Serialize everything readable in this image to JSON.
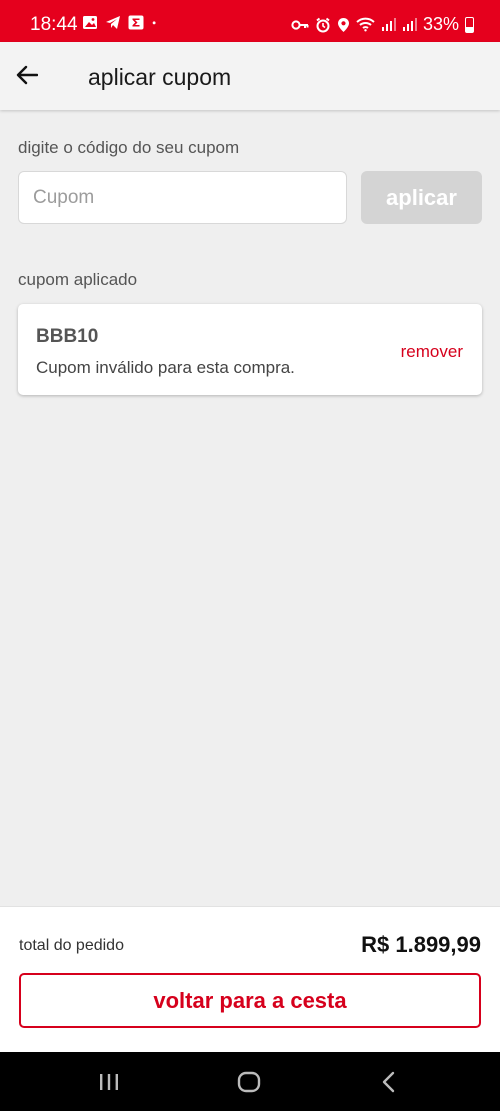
{
  "status_bar": {
    "time": "18:44",
    "battery": "33%",
    "background_color": "#e5001d",
    "left_icons": [
      "image-icon",
      "telegram-icon",
      "sigma-app-icon",
      "dot-icon"
    ],
    "right_icons": [
      "vpn-key-icon",
      "alarm-icon",
      "location-icon",
      "wifi-icon",
      "signal-icon",
      "signal-icon-2",
      "battery-icon"
    ]
  },
  "header": {
    "back_icon": "arrow-left-icon",
    "title": "aplicar cupom"
  },
  "coupon_form": {
    "label": "digite o código do seu cupom",
    "input_placeholder": "Cupom",
    "input_value": "",
    "apply_label": "aplicar"
  },
  "applied_coupon": {
    "section_label": "cupom aplicado",
    "code": "BBB10",
    "message": "Cupom inválido para esta compra.",
    "remove_label": "remover"
  },
  "summary": {
    "total_label": "total do pedido",
    "total_value": "R$ 1.899,99",
    "back_button_label": "voltar para a cesta"
  },
  "colors": {
    "accent": "#d6001c",
    "disabled_button": "#d4d4d4",
    "background": "#efefef"
  },
  "nav_bar": {
    "icons": [
      "recent-apps-icon",
      "home-icon",
      "back-icon"
    ]
  }
}
